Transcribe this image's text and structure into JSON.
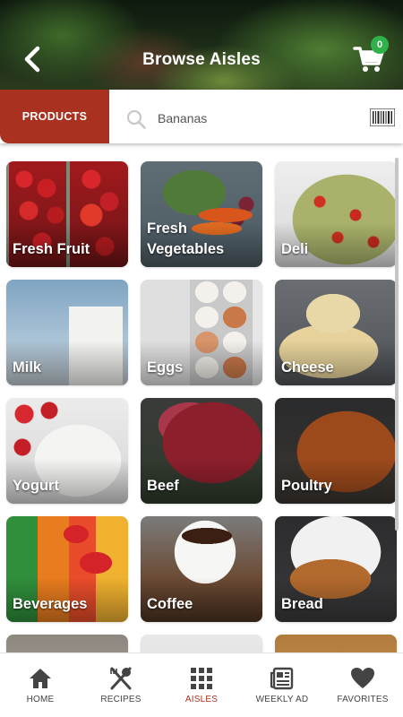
{
  "header": {
    "title": "Browse Aisles",
    "cart_count": "0"
  },
  "search": {
    "products_label": "PRODUCTS",
    "value": "Bananas"
  },
  "aisles": [
    {
      "label": "Fresh Fruit"
    },
    {
      "label": "Fresh Vegetables"
    },
    {
      "label": "Deli"
    },
    {
      "label": "Milk"
    },
    {
      "label": "Eggs"
    },
    {
      "label": "Cheese"
    },
    {
      "label": "Yogurt"
    },
    {
      "label": "Beef"
    },
    {
      "label": "Poultry"
    },
    {
      "label": "Beverages"
    },
    {
      "label": "Coffee"
    },
    {
      "label": "Bread"
    }
  ],
  "nav": {
    "items": [
      {
        "label": "HOME",
        "icon": "home-icon"
      },
      {
        "label": "RECIPES",
        "icon": "utensils-icon"
      },
      {
        "label": "AISLES",
        "icon": "grid-icon"
      },
      {
        "label": "WEEKLY AD",
        "icon": "newspaper-icon"
      },
      {
        "label": "FAVORITES",
        "icon": "heart-icon"
      }
    ],
    "active": "AISLES"
  },
  "colors": {
    "accent": "#a8321f",
    "badge": "#2fb24a",
    "nav_icon": "#444444"
  }
}
